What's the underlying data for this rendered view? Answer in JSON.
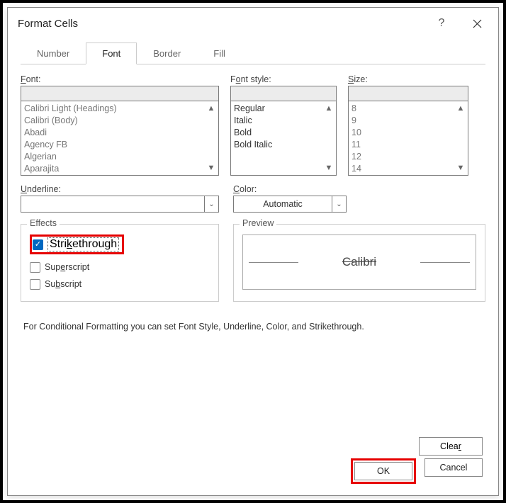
{
  "titlebar": {
    "title": "Format Cells",
    "help": "?",
    "close": "×"
  },
  "tabs": {
    "number": "Number",
    "font": "Font",
    "border": "Border",
    "fill": "Fill",
    "active": "font"
  },
  "labels": {
    "font": "Font:",
    "fontstyle": "Font style:",
    "size": "Size:",
    "underline": "Underline:",
    "color": "Color:",
    "effects": "Effects",
    "preview": "Preview",
    "strikethrough": "Strikethrough",
    "superscript": "Superscript",
    "subscript": "Subscript"
  },
  "fontList": [
    "Calibri Light (Headings)",
    "Calibri (Body)",
    "Abadi",
    "Agency FB",
    "Algerian",
    "Aparajita"
  ],
  "styleList": [
    "Regular",
    "Italic",
    "Bold",
    "Bold Italic"
  ],
  "sizeList": [
    "8",
    "9",
    "10",
    "11",
    "12",
    "14"
  ],
  "underline": {
    "value": ""
  },
  "color": {
    "value": "Automatic"
  },
  "effects": {
    "strikethrough": true,
    "superscript": false,
    "subscript": false
  },
  "preview": {
    "text": "Calibri"
  },
  "note": "For Conditional Formatting you can set Font Style, Underline, Color, and Strikethrough.",
  "buttons": {
    "clear": "Clear",
    "ok": "OK",
    "cancel": "Cancel"
  },
  "highlight": {
    "strikethrough": true,
    "ok": true
  }
}
